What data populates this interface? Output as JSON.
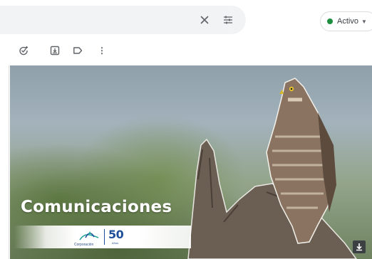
{
  "search": {
    "clear_icon": "close-icon",
    "options_icon": "tune-icon"
  },
  "status": {
    "label": "Activo",
    "color": "#1e8e3e",
    "icon": "chevron-down-icon"
  },
  "toolbar": {
    "icons": [
      "add-task-icon",
      "download-icon",
      "label-icon",
      "more-vert-icon"
    ]
  },
  "banner": {
    "title": "Comunicaciones",
    "logo_name": "Corporación",
    "logo_number": "50",
    "logo_suffix": "Años"
  }
}
